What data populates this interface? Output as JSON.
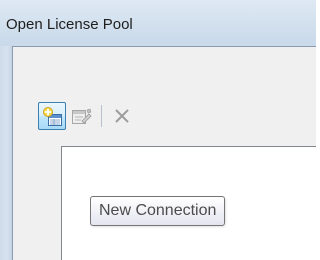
{
  "window": {
    "title": "Open License Pool"
  },
  "toolbar": {
    "buttons": [
      {
        "name": "new-connection",
        "icon": "new-connection-icon",
        "state": "hover"
      },
      {
        "name": "properties",
        "icon": "properties-icon",
        "state": "disabled"
      },
      {
        "name": "delete",
        "icon": "delete-x-icon",
        "state": "disabled"
      }
    ]
  },
  "tooltip": {
    "text": "New Connection"
  },
  "colors": {
    "titlebar": "#d2e0ee",
    "hover_border": "#3c7fb1",
    "disabled_icon": "#a0a0a0"
  }
}
